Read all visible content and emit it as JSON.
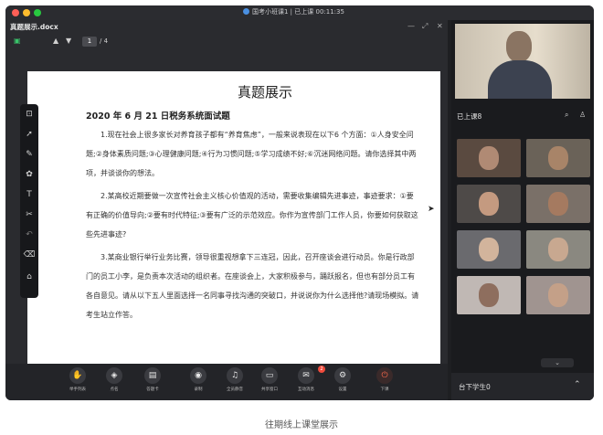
{
  "window": {
    "title": "国考小班课1 | 已上课 00:11:35"
  },
  "document": {
    "filename": "真题展示.docx",
    "current_page": "1",
    "total_pages": "/ 4",
    "title": "真题展示",
    "subtitle": "2020 年 6 月 21 日税务系统面试题",
    "paragraphs": [
      "1.现在社会上很多家长对养育孩子都有“养育焦虑”，一般来说表现在以下6 个方面：①人身安全问题;②身体素质问题;③心理健康问题;④行为习惯问题;⑤学习成绩不好;⑥沉迷网络问题。请你选择其中两项，并谈谈你的想法。",
      "2.某高校近期要做一次宣传社会主义核心价值观的活动，需要收集编辑先进事迹，事迹要求：①要有正确的价值导向;②要有时代特征;③要有广泛的示范效应。你作为宣传部门工作人员，你要如何获取这些先进事迹?",
      "3.某商业银行举行业务比赛，领导很重视想拿下三连冠，因此，召开座谈会进行动员。你是行政部门的员工小李，是负责本次活动的组织者。在座谈会上，大家积极参与，踊跃报名，但也有部分员工有各自意见。请从以下五人里面选择一名同事寻找沟通的突破口，并说说你为什么选择他?请现场模拟。请考生站立作答。"
    ]
  },
  "right_panel": {
    "students_header": "已上课8",
    "bottom_label": "台下学生0"
  },
  "bottom_bar": [
    {
      "label": "举手列表",
      "icon": "hand-icon"
    },
    {
      "label": "点名",
      "icon": "shield-icon"
    },
    {
      "label": "答题卡",
      "icon": "card-icon"
    },
    {
      "label": "录制",
      "icon": "record-icon"
    },
    {
      "label": "全员静音",
      "icon": "mute-icon"
    },
    {
      "label": "共享窗口",
      "icon": "share-icon"
    },
    {
      "label": "互动消息",
      "icon": "chat-icon"
    },
    {
      "label": "设置",
      "icon": "gear-icon"
    },
    {
      "label": "下课",
      "icon": "power-icon"
    }
  ],
  "message_badge": "2",
  "caption": "往期线上课堂展示",
  "colors": {
    "window_bg": "#1e1f22",
    "end_class": "#ff6a4d",
    "badge": "#f04b3c"
  }
}
